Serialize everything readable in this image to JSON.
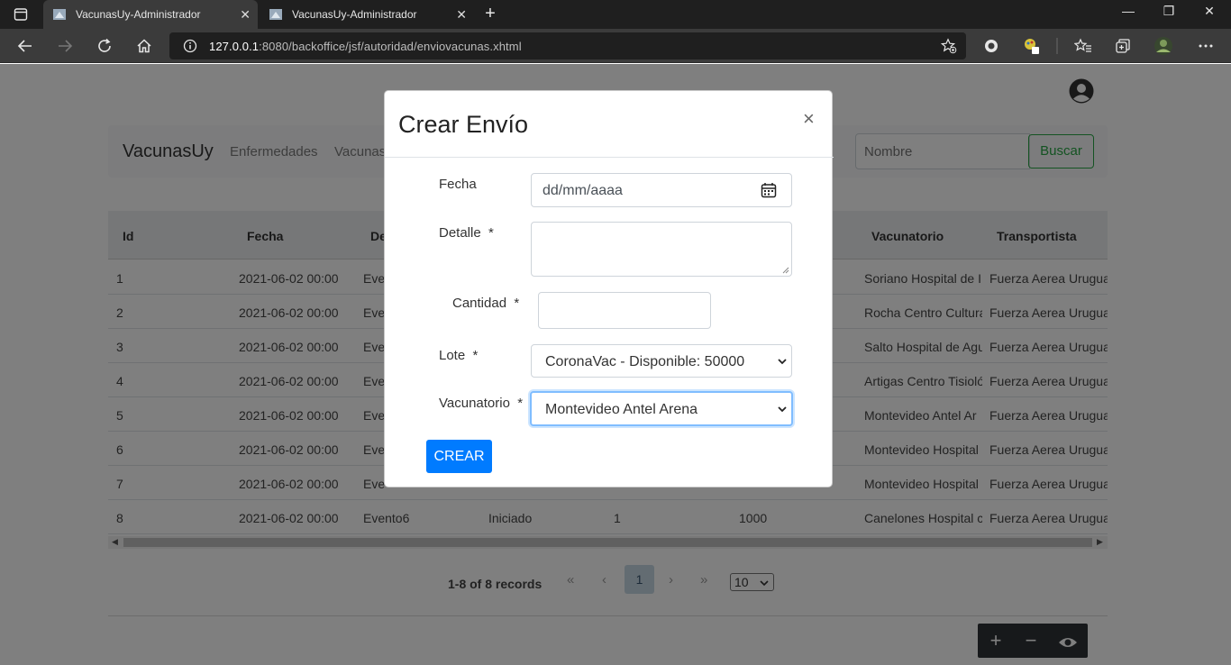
{
  "browser": {
    "tabs": [
      {
        "title": "VacunasUy-Administrador",
        "active": true
      },
      {
        "title": "VacunasUy-Administrador",
        "active": false
      }
    ],
    "url_host": "127.0.0.1",
    "url_rest": ":8080/backoffice/jsf/autoridad/enviovacunas.xhtml"
  },
  "navbar": {
    "brand": "VacunasUy",
    "links": [
      "Enfermedades",
      "Vacunas"
    ],
    "search_placeholder": "Nombre",
    "search_button": "Buscar"
  },
  "table": {
    "headers": [
      "Id",
      "Fecha",
      "De",
      "Vacunatorio",
      "Transportista"
    ],
    "rows": [
      {
        "id": "1",
        "fecha": "2021-06-02 00:00",
        "detalle": "Eve",
        "vacunatorio": "Soriano Hospital de I",
        "transportista": "Fuerza Aerea Urugua"
      },
      {
        "id": "2",
        "fecha": "2021-06-02 00:00",
        "detalle": "Eve",
        "vacunatorio": "Rocha Centro Cultura",
        "transportista": "Fuerza Aerea Urugua"
      },
      {
        "id": "3",
        "fecha": "2021-06-02 00:00",
        "detalle": "Eve",
        "vacunatorio": "Salto Hospital de Agu",
        "transportista": "Fuerza Aerea Urugua"
      },
      {
        "id": "4",
        "fecha": "2021-06-02 00:00",
        "detalle": "Eve",
        "vacunatorio": "Artigas Centro Tisioló",
        "transportista": "Fuerza Aerea Urugua"
      },
      {
        "id": "5",
        "fecha": "2021-06-02 00:00",
        "detalle": "Eve",
        "vacunatorio": "Montevideo Antel Ar",
        "transportista": "Fuerza Aerea Urugua"
      },
      {
        "id": "6",
        "fecha": "2021-06-02 00:00",
        "detalle": "Eve",
        "vacunatorio": "Montevideo Hospital",
        "transportista": "Fuerza Aerea Urugua"
      },
      {
        "id": "7",
        "fecha": "2021-06-02 00:00",
        "detalle": "Eve",
        "vacunatorio": "Montevideo Hospital",
        "transportista": "Fuerza Aerea Urugua"
      },
      {
        "id": "8",
        "fecha": "2021-06-02 00:00",
        "detalle": "Evento6",
        "estado": "Iniciado",
        "cantidad_lote": "1",
        "cantidad": "1000",
        "vacunatorio": "Canelones Hospital c",
        "transportista": "Fuerza Aerea Urugua"
      }
    ]
  },
  "paginator": {
    "summary": "1-8 of 8 records",
    "first": "«",
    "prev": "‹",
    "current_page": "1",
    "next": "›",
    "last": "»",
    "rows_per_page": "10"
  },
  "fab": {
    "add": "+",
    "remove": "−"
  },
  "modal": {
    "title": "Crear Envío",
    "close": "×",
    "fields": {
      "fecha": {
        "label": "Fecha",
        "placeholder": "dd/mm/aaaa"
      },
      "detalle": {
        "label": "Detalle  *",
        "value": ""
      },
      "cantidad": {
        "label": "Cantidad  *",
        "value": ""
      },
      "lote": {
        "label": "Lote  *",
        "value": "CoronaVac - Disponible: 50000"
      },
      "vacunatorio": {
        "label": "Vacunatorio  *",
        "value": "Montevideo Antel Arena"
      }
    },
    "submit": "CREAR"
  }
}
